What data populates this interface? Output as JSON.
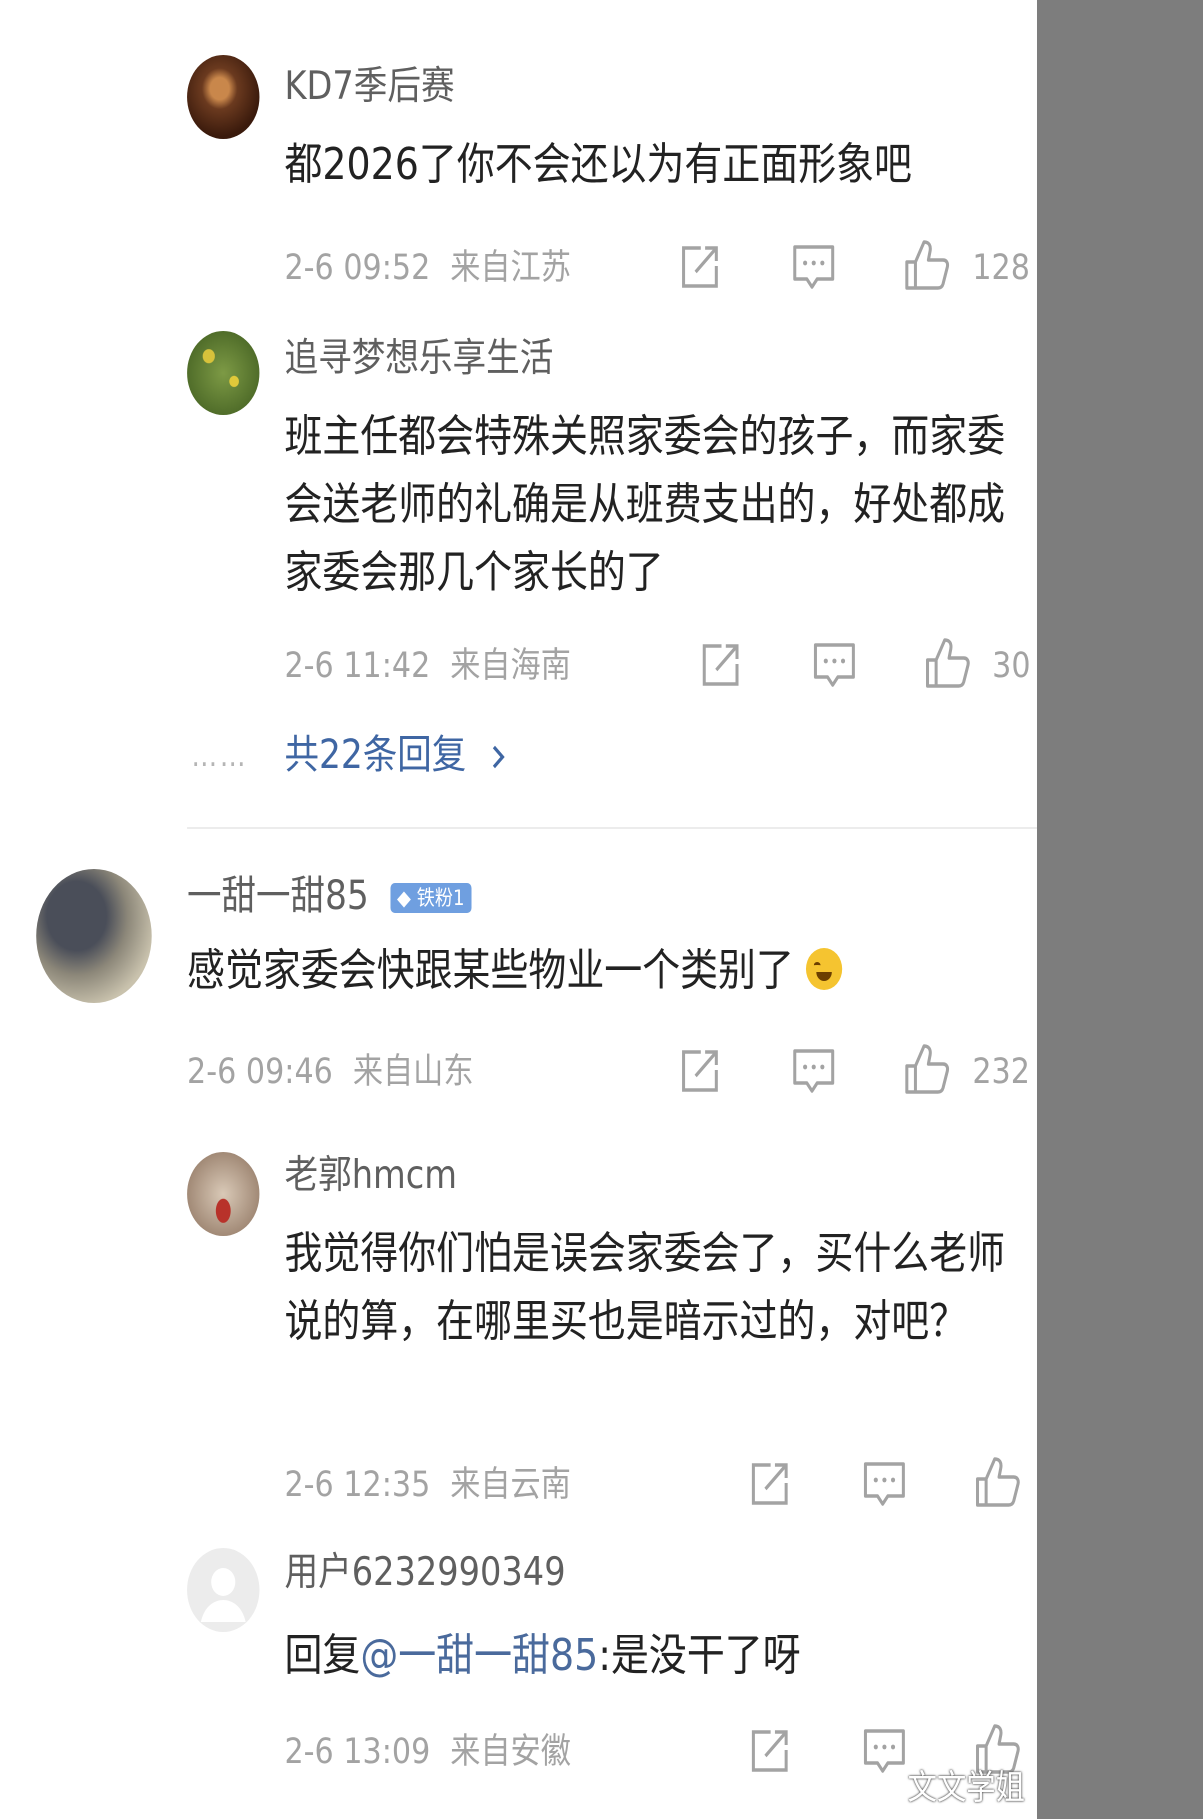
{
  "comments": [
    {
      "user": "KD7季后赛",
      "text": "都2026了你不会还以为有正面形象吧",
      "time": "2-6 09:52",
      "location": "来自江苏",
      "likes": "128"
    },
    {
      "user": "追寻梦想乐享生活",
      "text": "班主任都会特殊关照家委会的孩子，而家委会送老师的礼确是从班费支出的，好处都成家委会那几个家长的了",
      "time": "2-6 11:42",
      "location": "来自海南",
      "likes": "30"
    },
    {
      "user": "一甜一甜85",
      "badge": "铁粉1",
      "text": "感觉家委会快跟某些物业一个类别了",
      "time": "2-6 09:46",
      "location": "来自山东",
      "likes": "232"
    },
    {
      "user": "老郭hmcm",
      "text": "我觉得你们怕是误会家委会了，买什么老师说的算，在哪里买也是暗示过的，对吧？",
      "time": "2-6 12:35",
      "location": "来自云南"
    },
    {
      "user": "用户6232990349",
      "reply_prefix": "回复",
      "mention": "@一甜一甜85",
      "text": ":是没干了呀",
      "time": "2-6 13:09",
      "location": "来自安徽"
    }
  ],
  "more_replies": "共22条回复",
  "more_dots": "……",
  "watermark": "文文学姐",
  "icons": {
    "share": "share-icon",
    "comment": "comment-icon",
    "like": "thumbs-up-icon",
    "chevron": "chevron-right-icon",
    "emoji": "laugh-cry-emoji-icon"
  },
  "colors": {
    "link": "#3f66a3",
    "meta": "#a3a3a3",
    "badge": "#6f9fe0"
  }
}
